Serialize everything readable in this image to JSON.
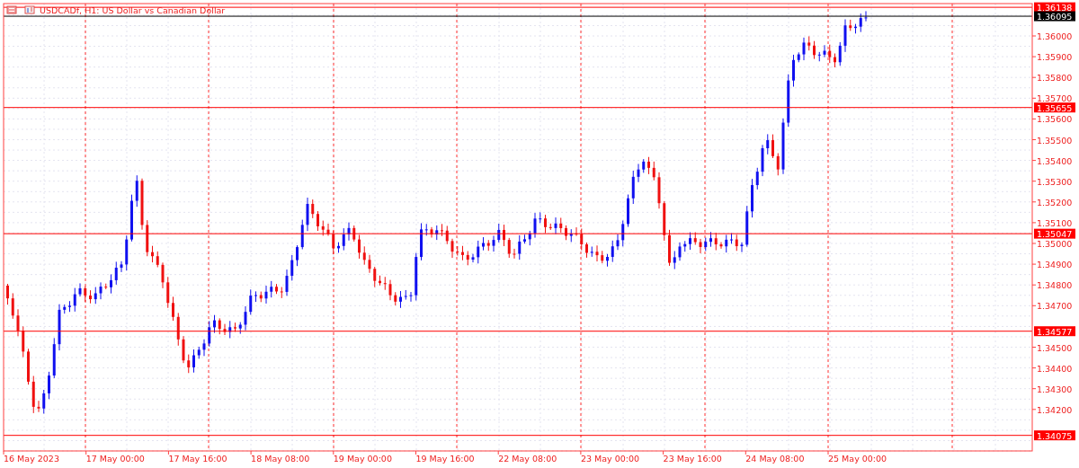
{
  "chart": {
    "title": "USDCADf, H1:  US Dollar vs Canadian Dollar",
    "price_axis": [
      "1.36000",
      "1.35900",
      "1.35800",
      "1.35700",
      "1.35600",
      "1.35500",
      "1.35400",
      "1.35300",
      "1.35200",
      "1.35100",
      "1.35000",
      "1.34900",
      "1.34800",
      "1.34700",
      "1.34500",
      "1.34400",
      "1.34300",
      "1.34200"
    ],
    "time_axis": [
      "16 May 2023",
      "17 May 00:00",
      "17 May 16:00",
      "18 May 08:00",
      "19 May 00:00",
      "19 May 16:00",
      "22 May 08:00",
      "23 May 00:00",
      "23 May 16:00",
      "24 May 08:00",
      "25 May 00:00"
    ],
    "price_lines": [
      {
        "label": "1.36138",
        "color": "#ff0000"
      },
      {
        "label": "1.36095",
        "color": "#000000"
      },
      {
        "label": "1.35655",
        "color": "#ff0000"
      },
      {
        "label": "1.35047",
        "color": "#ff0000"
      },
      {
        "label": "1.34577",
        "color": "#ff0000"
      },
      {
        "label": "1.34075",
        "color": "#ff0000"
      }
    ]
  }
}
